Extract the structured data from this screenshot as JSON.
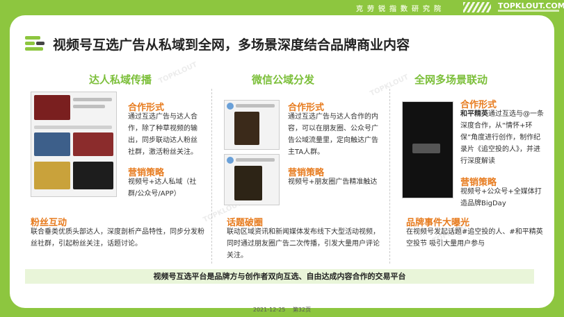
{
  "header": {
    "org_name": "克劳锐指数研究院",
    "brand": "TOPKLOUT.COM",
    "brand_colors": {
      "accent": "#8dc63f",
      "orange": "#e77b1e",
      "banner": "#e9f5d9"
    }
  },
  "page_title": "视频号互选广告从私域到全网，多场景深度结合品牌商业内容",
  "columns": [
    {
      "heading": "达人私域传播",
      "sections": [
        {
          "title": "合作形式",
          "text": "通过互选广告与达人合作，除了种草视频的输出，同步联动达人粉丝社群，激活粉丝关注。"
        },
        {
          "title": "营销策略",
          "text": "视频号+达人私域（社群/公众号/APP）"
        },
        {
          "title": "粉丝互动",
          "text": "联合垂类优质头部达人，深度剖析产品特性，同步分发粉丝社群，引起粉丝关注，话题讨论。"
        }
      ]
    },
    {
      "heading": "微信公域分发",
      "sections": [
        {
          "title": "合作形式",
          "text": "通过互选广告与达人合作的内容，可以在朋友圈、公众号广告公域流量里，定向触达广告主TA人群。"
        },
        {
          "title": "营销策略",
          "text": "视频号+朋友圈广告精准触达"
        },
        {
          "title": "话题破圈",
          "text": "联动区域资讯和新闻媒体发布线下大型活动视频，同时通过朋友圈广告二次传播，引发大量用户评论关注。"
        }
      ]
    },
    {
      "heading": "全网多场景联动",
      "sections": [
        {
          "title": "合作形式",
          "bold_lead": "和平精英",
          "text": "通过互选与@一条深度合作，从“情怀+环保”角度进行创作，制作纪录片《追空投的人》，并进行深度解读"
        },
        {
          "title": "营销策略",
          "text": "视频号+公众号+全媒体打造品牌BigDay"
        },
        {
          "title": "品牌事件大曝光",
          "text": "在视频号发起话题#追空投的人、#和平精英空投节 吸引大量用户参与"
        }
      ]
    }
  ],
  "banner": "视频号互选平台是品牌方与创作者双向互选、自由达成内容合作的交易平台",
  "footer": {
    "date": "2021-12-25",
    "page": "第32页"
  }
}
